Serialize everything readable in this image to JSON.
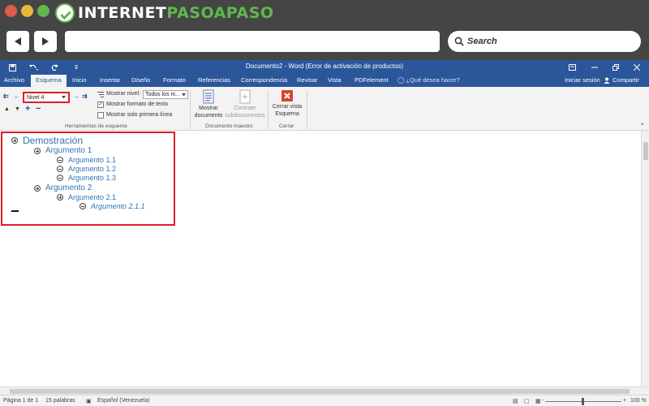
{
  "browser": {
    "logo_main": "INTERNET",
    "logo_accent": "PASOAPASO",
    "search_placeholder": "Search"
  },
  "titlebar": {
    "title": "Documento2 - Word (Error de activación de productos)"
  },
  "tabs": [
    {
      "label": "Archivo",
      "active": false
    },
    {
      "label": "Esquema",
      "active": true
    },
    {
      "label": "Inicio",
      "active": false
    },
    {
      "label": "Insertar",
      "active": false
    },
    {
      "label": "Diseño",
      "active": false
    },
    {
      "label": "Formato",
      "active": false
    },
    {
      "label": "Referencias",
      "active": false
    },
    {
      "label": "Correspondencia",
      "active": false
    },
    {
      "label": "Revisar",
      "active": false
    },
    {
      "label": "Vista",
      "active": false
    },
    {
      "label": "PDFelement",
      "active": false
    }
  ],
  "tell_me": "¿Qué desea hacer?",
  "account": {
    "signin": "Iniciar sesión",
    "share": "Compartir"
  },
  "ribbon": {
    "level_value": "Nivel 4",
    "show_level_label": "Mostrar nivel:",
    "show_level_value": "Todos los ni...",
    "show_format_label": "Mostrar formato de texto",
    "show_format_checked": true,
    "first_line_label": "Mostrar solo primera línea",
    "first_line_checked": false,
    "tools_group_label": "Herramientas de esquema",
    "show_document": [
      "Mostrar",
      "documento"
    ],
    "collapse_subdocs": [
      "Contraer",
      "subdocumentos"
    ],
    "master_group_label": "Documento maestro",
    "close_outline": [
      "Cerrar vista",
      "Esquema"
    ],
    "close_group_label": "Cerrar"
  },
  "outline": [
    {
      "text": "Demostración",
      "level": 1,
      "symbol": "plus"
    },
    {
      "text": "Argumento 1",
      "level": 2,
      "symbol": "plus"
    },
    {
      "text": "Argumento 1.1",
      "level": 3,
      "symbol": "minus"
    },
    {
      "text": "Argumento 1.2",
      "level": 3,
      "symbol": "minus"
    },
    {
      "text": "Argumento 1.3",
      "level": 3,
      "symbol": "minus"
    },
    {
      "text": "Argumento 2",
      "level": 2,
      "symbol": "plus"
    },
    {
      "text": "Argumento 2.1",
      "level": 3,
      "symbol": "plus"
    },
    {
      "text": "Argumento 2.1.1",
      "level": 4,
      "symbol": "minus"
    }
  ],
  "status": {
    "page": "Página 1 de 1",
    "words": "15 palabras",
    "language": "Español (Venezuela)",
    "zoom_minus": "-",
    "zoom_plus": "+",
    "zoom": "100 %"
  },
  "colors": {
    "word_blue": "#2b579a",
    "heading_blue": "#2e74b5",
    "highlight_red": "#d91f26"
  }
}
